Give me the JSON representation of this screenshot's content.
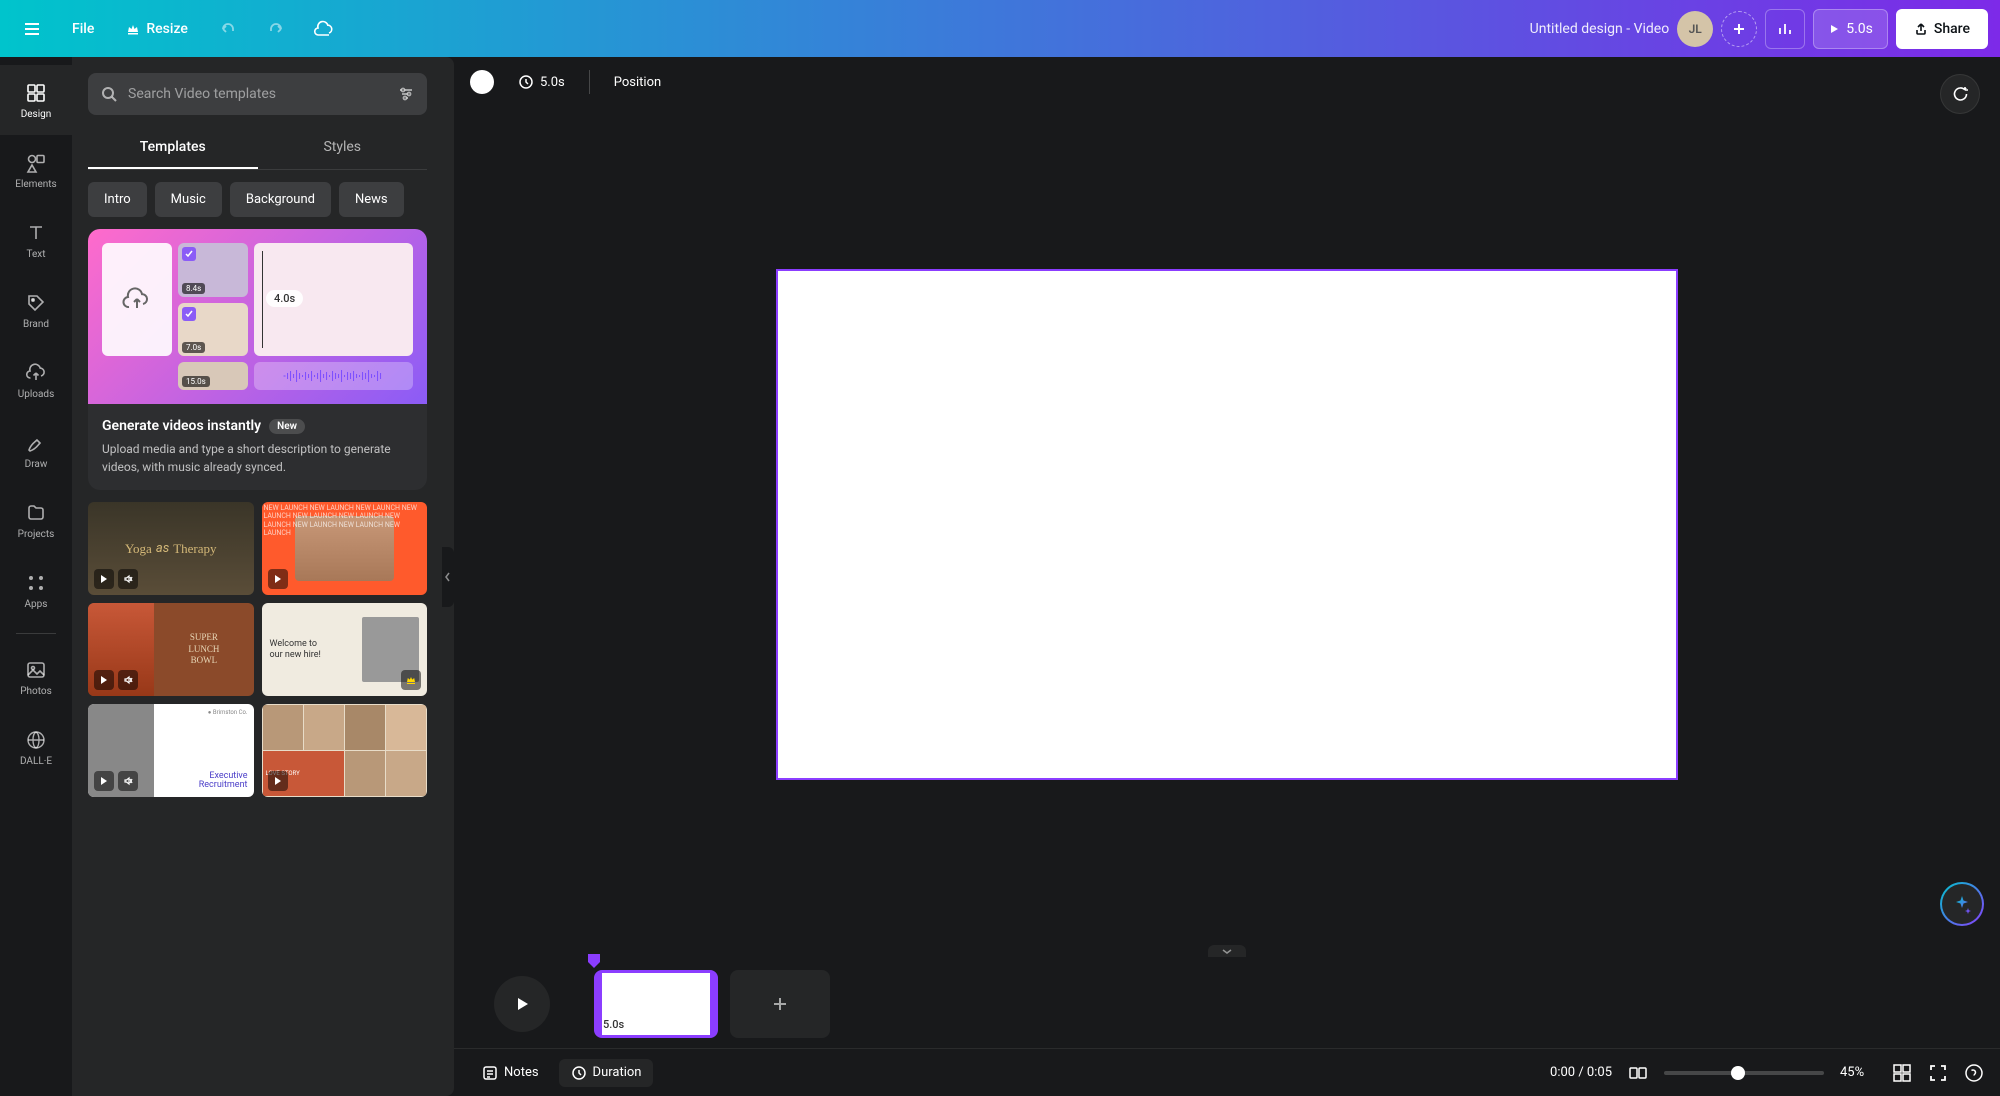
{
  "header": {
    "file_label": "File",
    "resize_label": "Resize",
    "title": "Untitled design - Video",
    "avatar_initials": "JL",
    "duration_label": "5.0s",
    "share_label": "Share"
  },
  "nav": [
    {
      "label": "Design",
      "active": true
    },
    {
      "label": "Elements",
      "active": false
    },
    {
      "label": "Text",
      "active": false
    },
    {
      "label": "Brand",
      "active": false
    },
    {
      "label": "Uploads",
      "active": false
    },
    {
      "label": "Draw",
      "active": false
    },
    {
      "label": "Projects",
      "active": false
    },
    {
      "label": "Apps",
      "active": false
    },
    {
      "label": "Photos",
      "active": false
    },
    {
      "label": "DALL·E",
      "active": false
    }
  ],
  "panel": {
    "search_placeholder": "Search Video templates",
    "tabs": {
      "templates": "Templates",
      "styles": "Styles"
    },
    "chips": [
      "Intro",
      "Music",
      "Background",
      "News"
    ],
    "promo": {
      "title": "Generate videos instantly",
      "badge": "New",
      "desc": "Upload media and type a short description to generate videos, with music already synced.",
      "tiles": {
        "t1_dur": "8.4s",
        "t2_dur": "7.0s",
        "t3_dur": "15.0s",
        "big_dur": "4.0s"
      }
    }
  },
  "canvas_toolbar": {
    "duration_label": "5.0s",
    "position_label": "Position"
  },
  "timeline": {
    "clip_label": "5.0s"
  },
  "bottom": {
    "notes_label": "Notes",
    "duration_label": "Duration",
    "time": "0:00 / 0:05",
    "zoom": "45%"
  }
}
